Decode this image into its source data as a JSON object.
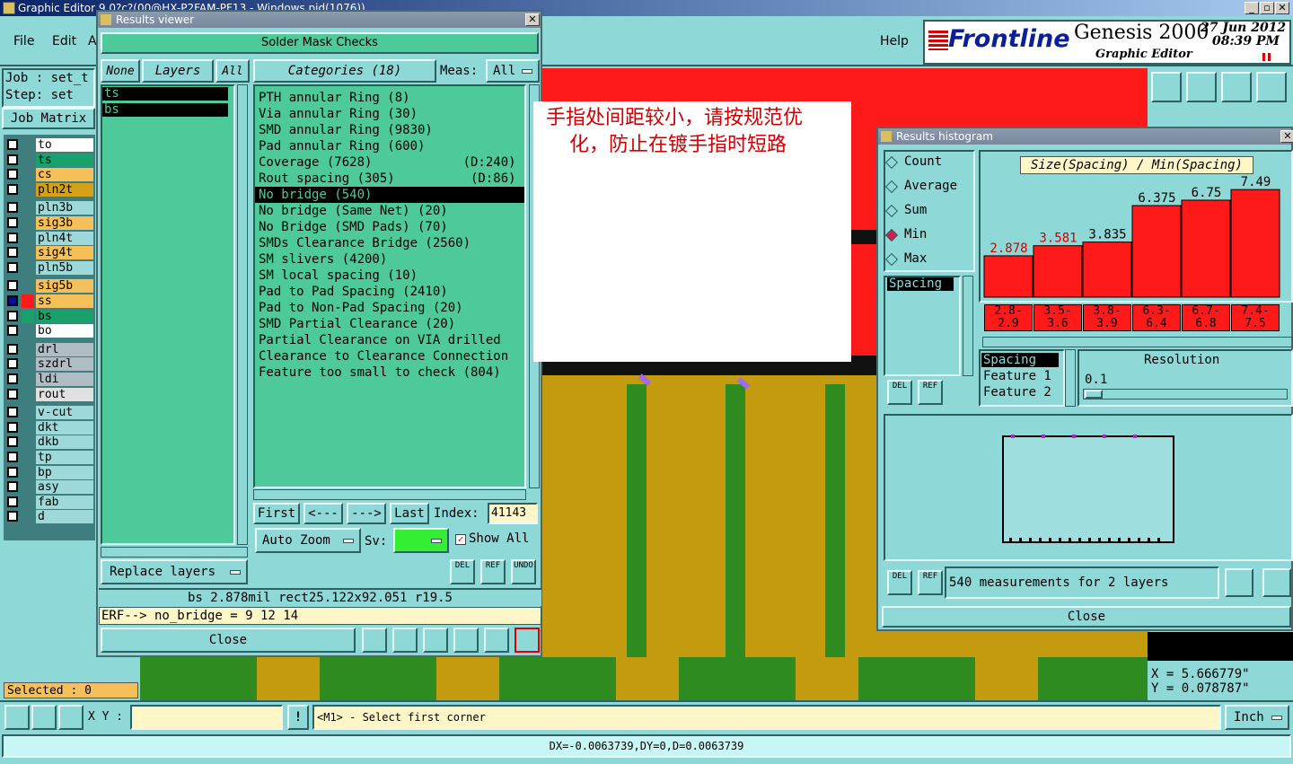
{
  "app": {
    "title": "Graphic Editor 9.0?c?(00@HX-P2FAM-PF13 - Windows pid(1076))",
    "menu": [
      "File",
      "Edit",
      "A"
    ],
    "help": "Help"
  },
  "brand": {
    "logo": "Frontline",
    "product": "Genesis 2000",
    "subtitle": "Graphic Editor",
    "date": "27 Jun 2012",
    "time": "08:39 PM"
  },
  "job": {
    "job_label": "Job : set_t",
    "step_label": "Step: set",
    "job_matrix": "Job Matrix",
    "selected": "Selected : 0"
  },
  "layers": [
    {
      "name": "to",
      "color": "#ffffff"
    },
    {
      "name": "ts",
      "color": "#1aa06a"
    },
    {
      "name": "cs",
      "color": "#f5c05a"
    },
    {
      "name": "pln2t",
      "color": "#d4a017"
    },
    {
      "name": "pln3b",
      "color": "#9ed8d8"
    },
    {
      "name": "sig3b",
      "color": "#f5c05a"
    },
    {
      "name": "pln4t",
      "color": "#9ed8d8"
    },
    {
      "name": "sig4t",
      "color": "#f5c05a"
    },
    {
      "name": "pln5b",
      "color": "#9ed8d8"
    },
    {
      "name": "sig5b",
      "color": "#f5c05a"
    },
    {
      "name": "ss",
      "color": "#f5c05a"
    },
    {
      "name": "bs",
      "color": "#1aa06a"
    },
    {
      "name": "bo",
      "color": "#ffffff"
    },
    {
      "name": "drl",
      "color": "#b0bcc4"
    },
    {
      "name": "szdrl",
      "color": "#b0bcc4"
    },
    {
      "name": "ldi",
      "color": "#b0bcc4"
    },
    {
      "name": "rout",
      "color": "#e0e0e0"
    },
    {
      "name": "v-cut",
      "color": "#9ed8d8"
    },
    {
      "name": "dkt",
      "color": "#9ed8d8"
    },
    {
      "name": "dkb",
      "color": "#9ed8d8"
    },
    {
      "name": "tp",
      "color": "#9ed8d8"
    },
    {
      "name": "bp",
      "color": "#9ed8d8"
    },
    {
      "name": "asy",
      "color": "#9ed8d8"
    },
    {
      "name": "fab",
      "color": "#9ed8d8"
    },
    {
      "name": "d",
      "color": "#9ed8d8"
    }
  ],
  "results": {
    "window_title": "Results viewer",
    "heading": "Solder Mask Checks",
    "none": "None",
    "layers": "Layers",
    "all": "All",
    "layer_list": [
      "ts",
      "bs"
    ],
    "categories_label": "Categories (18)",
    "meas_label": "Meas:",
    "meas_value": "All",
    "categories": [
      "PTH annular Ring (8)",
      "Via annular Ring (30)",
      "SMD annular Ring (9830)",
      "Pad annular Ring (600)",
      "Coverage (7628)            (D:240)",
      "Rout spacing (305)          (D:86)",
      "No bridge (540)",
      "No bridge (Same Net) (20)",
      "No Bridge (SMD Pads) (70)",
      "SMDs Clearance Bridge (2560)",
      "SM slivers (4200)",
      "SM local spacing (10)",
      "Pad to Pad Spacing (2410)",
      "Pad to Non-Pad Spacing (20)",
      "SMD Partial Clearance (20)",
      "Partial Clearance on VIA drilled",
      "Clearance to Clearance Connection",
      "Feature too small to check (804)"
    ],
    "selected_index": 6,
    "nav": {
      "first": "First",
      "prev": "<---",
      "next": "--->",
      "last": "Last",
      "index_label": "Index:",
      "index_value": "41143"
    },
    "auto_zoom": "Auto Zoom",
    "sv": "Sv:",
    "show_all": "Show All",
    "replace_layers": "Replace layers",
    "del": "DEL",
    "ref": "REF",
    "undo": "UNDO",
    "status": "bs 2.878mil   rect25.122x92.051   r19.5",
    "erf": "ERF--> no_bridge = 9 12 14",
    "close": "Close"
  },
  "note": {
    "text_line1": "手指处间距较小，请按规范优",
    "text_line2": "化，防止在镀手指时短路"
  },
  "histogram": {
    "window_title": "Results histogram",
    "modes": [
      "Count",
      "Average",
      "Sum",
      "Min",
      "Max"
    ],
    "selected_mode": 3,
    "list": [
      "Spacing"
    ],
    "title": "Size(Spacing) / Min(Spacing)",
    "bars": [
      2.878,
      3.581,
      3.835,
      6.375,
      6.75,
      7.49
    ],
    "bar_labels": [
      "2.878",
      "3.581",
      "3.835",
      "6.375",
      "6.75",
      "7.49"
    ],
    "bar_label_colors": [
      "#d00000",
      "#d00000",
      "#000000",
      "#000000",
      "#000000",
      "#000000"
    ],
    "bins_top": [
      "2.8-",
      "3.5-",
      "3.8-",
      "6.3-",
      "6.7-",
      "7.4-"
    ],
    "bins_bottom": [
      "2.9",
      "3.6",
      "3.9",
      "6.4",
      "6.8",
      "7.5"
    ],
    "features": [
      "Spacing",
      "Feature 1",
      "Feature 2"
    ],
    "resolution_label": "Resolution",
    "resolution_value": "0.1",
    "del": "DEL",
    "ref": "REF",
    "summary": "540 measurements for 2 layers",
    "close": "Close"
  },
  "coords": {
    "x": "X = 5.666779\"",
    "y": "Y = 0.078787\""
  },
  "bottom": {
    "xy_label": "X Y :",
    "prompt": "<M1> - Select first corner",
    "unit": "Inch",
    "status": "DX=-0.0063739,DY=0,D=0.0063739"
  },
  "colors": {
    "teal": "#8fd8d8",
    "panel_green": "#4ec99a",
    "board_red": "#ff1a1a",
    "gold": "#c49a0e",
    "green": "#2e8b1f"
  }
}
